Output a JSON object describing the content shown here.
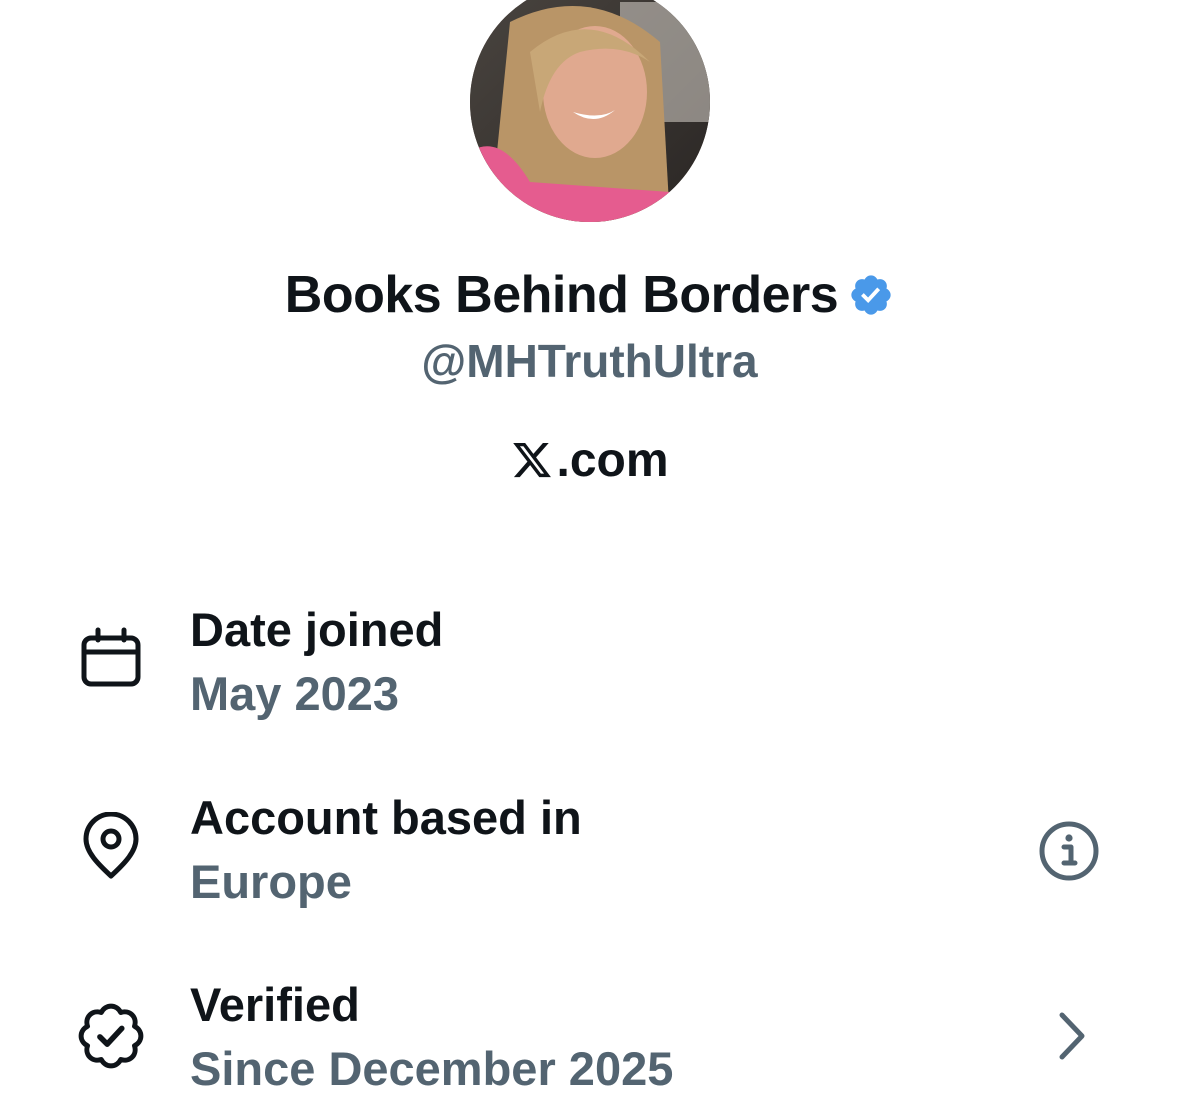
{
  "profile": {
    "display_name": "Books Behind Borders",
    "handle": "@MHTruthUltra",
    "site_text": ".com",
    "verified_color": "#4a99e9"
  },
  "details": [
    {
      "icon": "calendar-icon",
      "title": "Date joined",
      "value": "May 2023"
    },
    {
      "icon": "location-pin-icon",
      "title": "Account based in",
      "value": "Europe",
      "action": "info-icon"
    },
    {
      "icon": "verified-badge-icon",
      "title": "Verified",
      "value": "Since December 2025",
      "action": "chevron-right-icon"
    }
  ],
  "colors": {
    "primary_text": "#0f1419",
    "secondary_text": "#536471"
  }
}
